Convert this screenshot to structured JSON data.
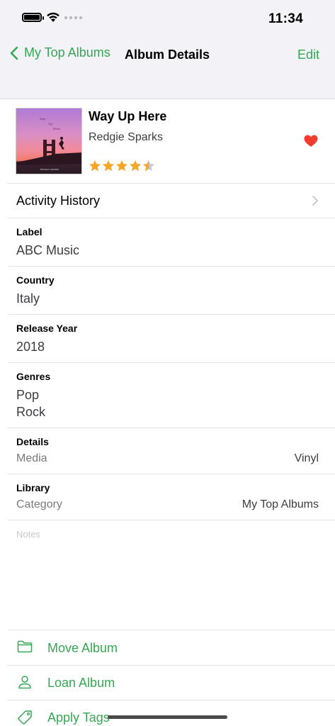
{
  "status_bar": {
    "time": "11:34"
  },
  "nav": {
    "back_label": "My Top Albums",
    "title": "Album Details",
    "edit_label": "Edit"
  },
  "album": {
    "title": "Way Up Here",
    "artist": "Redgie Sparks",
    "rating": 4.5,
    "rating_max": 5,
    "favorite": true,
    "cover_text": {
      "line1": "Way",
      "line2": "Up",
      "line3": "Here",
      "footer": "REDGIE SPARKS"
    }
  },
  "activity": {
    "label": "Activity History"
  },
  "fields": {
    "label": {
      "title": "Label",
      "value": "ABC Music"
    },
    "country": {
      "title": "Country",
      "value": "Italy"
    },
    "release_year": {
      "title": "Release Year",
      "value": "2018"
    },
    "genres": {
      "title": "Genres",
      "values": [
        "Pop",
        "Rock"
      ]
    },
    "details": {
      "title": "Details",
      "key": "Media",
      "value": "Vinyl"
    },
    "library": {
      "title": "Library",
      "key": "Category",
      "value": "My Top Albums"
    }
  },
  "notes": {
    "placeholder": "Notes"
  },
  "actions": [
    {
      "label": "Move Album",
      "icon": "folder-icon"
    },
    {
      "label": "Loan Album",
      "icon": "person-icon"
    },
    {
      "label": "Apply Tags",
      "icon": "tag-icon"
    }
  ],
  "colors": {
    "accent": "#34a853",
    "star": "#f5a623",
    "heart": "#f23b30"
  }
}
